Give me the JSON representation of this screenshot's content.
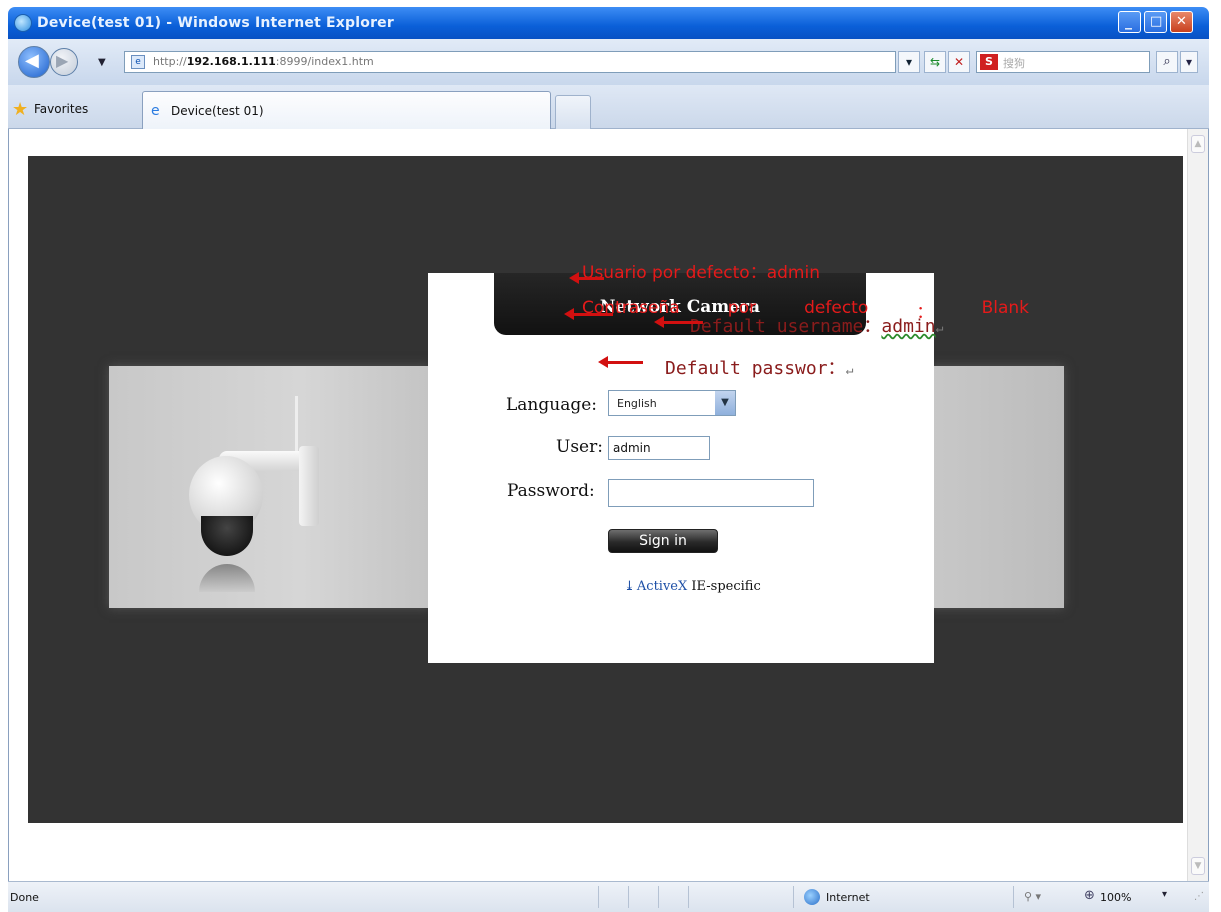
{
  "window": {
    "title": "Device(test 01) - Windows Internet Explorer",
    "min_glyph": "_",
    "max_glyph": "□",
    "close_glyph": "✕"
  },
  "address_bar": {
    "url_prefix": "http://",
    "url_host": "192.168.1.111",
    "url_rest": ":8999/index1.htm",
    "search_placeholder": "搜狗"
  },
  "favorites": {
    "label": "Favorites",
    "tab_title": "Device(test 01)"
  },
  "login": {
    "title": "Network Camera",
    "language_label": "Language:",
    "language_value": "English",
    "user_label": "User:",
    "user_value": "admin",
    "password_label": "Password:",
    "password_value": "",
    "signin_label": "Sign in",
    "activex_link": "ActiveX",
    "activex_suffix": "IE-specific"
  },
  "annotations": {
    "es_user": "Usuario por defecto：admin",
    "es_pass_1": "Contraseña",
    "es_pass_2": "por",
    "es_pass_3": "defecto",
    "es_pass_4": "：",
    "es_pass_5": "Blank",
    "en_user_text": "Default username：",
    "en_user_value": "admin",
    "en_user_mark": "↵",
    "en_pass_text": "Default passwor：",
    "en_pass_mark": "↵"
  },
  "status_bar": {
    "status": "Done",
    "zone": "Internet",
    "zoom": "100%"
  },
  "colors": {
    "annotation_red": "#e51a1a",
    "annotation_dark": "#8a1c1c",
    "title_bar_blue": "#0a5fd8",
    "stage_dark": "#333333"
  }
}
